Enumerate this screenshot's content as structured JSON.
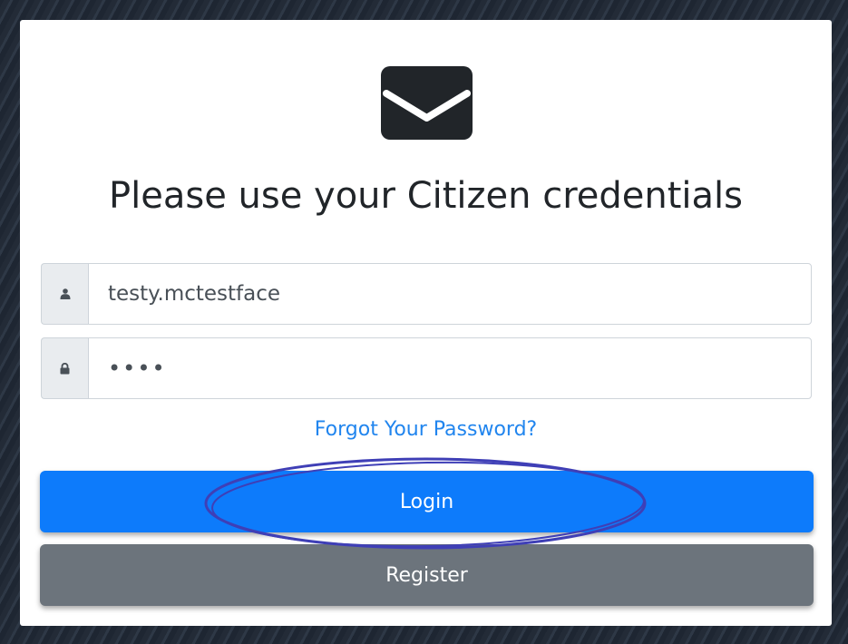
{
  "login_form": {
    "heading": "Please use your Citizen credentials",
    "envelope_icon": "envelope-icon",
    "username": {
      "icon": "user-icon",
      "value": "testy.mctestface"
    },
    "password": {
      "icon": "lock-icon",
      "value": "••••"
    },
    "forgot_link": "Forgot Your Password?",
    "login_label": "Login",
    "register_label": "Register"
  },
  "colors": {
    "primary": "#0d7bfb",
    "secondary": "#6c747c",
    "link": "#2185ee",
    "annotation": "#3f3fb6"
  }
}
